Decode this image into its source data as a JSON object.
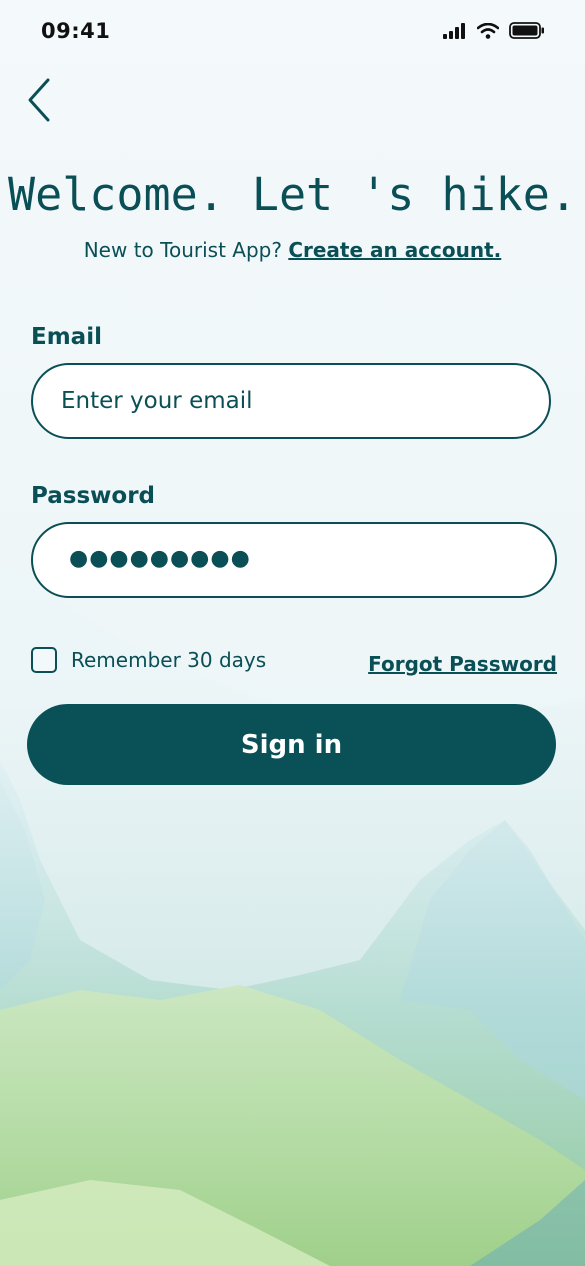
{
  "status": {
    "time": "09:41"
  },
  "header": {
    "title": "Welcome. Let 's hike.",
    "new_prefix": "New to Tourist App?",
    "create_link": "Create an account."
  },
  "form": {
    "email_label": "Email",
    "email_placeholder": "Enter your email",
    "password_label": "Password",
    "password_masked": "●●●●●●●●●",
    "remember_label": "Remember 30 days",
    "remember_checked": false,
    "forgot_link": "Forgot Password",
    "signin_label": "Sign in"
  },
  "colors": {
    "accent": "#0b4f56",
    "button": "#0a5157"
  },
  "icons": {
    "back": "chevron-left-icon",
    "signal": "signal-icon",
    "wifi": "wifi-icon",
    "battery": "battery-icon"
  }
}
